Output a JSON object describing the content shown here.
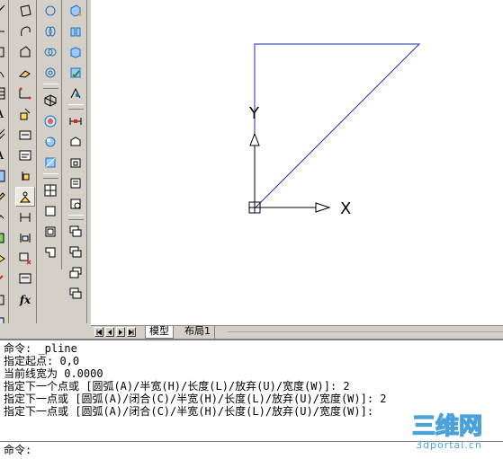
{
  "layout_tabs": {
    "model": "模型",
    "layout1": "布局1"
  },
  "ucs_icon": {
    "x_label": "X",
    "y_label": "Y"
  },
  "colors": {
    "polyline": "#1a2fb0",
    "ucs": "#000000",
    "canvas_bg": "#ffffff"
  },
  "command_window": {
    "history": [
      "命令: _pline",
      "指定起点: 0,0",
      "当前线宽为 0.0000",
      "指定下一个点或 [圆弧(A)/半宽(H)/长度(L)/放弃(U)/宽度(W)]: 2",
      "指定下一点或 [圆弧(A)/闭合(C)/半宽(H)/长度(L)/放弃(U)/宽度(W)]: 2",
      "指定下一点或 [圆弧(A)/闭合(C)/半宽(H)/长度(L)/放弃(U)/宽度(W)]:"
    ],
    "prompt": "命令:",
    "input_value": ""
  },
  "watermark": {
    "brand": "三维网",
    "site": "3dportal.cn"
  },
  "toolbars": {
    "col1": [
      "ray-icon",
      "rectangle-icon",
      "arc-icon",
      "circle-icon",
      "revision-cloud-icon",
      "spline-icon",
      "ellipse-icon",
      "table-icon",
      "mtext-icon",
      "polyline-icon",
      "measure-icon",
      "text-style-icon",
      "hatch-icon",
      "gradient-icon",
      "region-icon",
      "point-icon",
      "explode-icon",
      "match-properties-icon",
      "layer-icon",
      "paint-icon",
      "scale-icon",
      "insert-block-icon",
      "attach-icon"
    ],
    "col2": [
      "distance-icon",
      "quick-select-icon",
      "dimension-edit-icon",
      "text-edit-icon",
      "point-style-icon",
      "lock-icon",
      "block-editor-icon",
      "properties-icon",
      "block-insert-icon",
      "erase-block-icon",
      "field-icon",
      "formula-icon"
    ],
    "col3": [
      "sphere-icon",
      "cylinder-icon",
      "cone-icon",
      "union-icon",
      "subtract-icon",
      "intersect-icon",
      "3d-orbit-icon",
      "render-icon"
    ],
    "col4": [
      "viewport-icon",
      "window-icon",
      "scale-window-icon",
      "dimension-icon",
      "table-style-icon",
      "text-window-icon",
      "view-icon",
      "layer-state-icon",
      "cascade-icon",
      "tile-icon",
      "arrange-icon",
      "minimize-icon",
      "restore-icon"
    ],
    "col5": [
      "box-icon",
      "wedge-icon",
      "edit-solid-icon",
      "extrude-icon",
      "revolve-icon",
      "slice-icon",
      "section-icon",
      "interfere-icon",
      "draw-order-icon",
      "bring-front-icon",
      "send-back-icon",
      "above-icon",
      "below-icon"
    ]
  }
}
